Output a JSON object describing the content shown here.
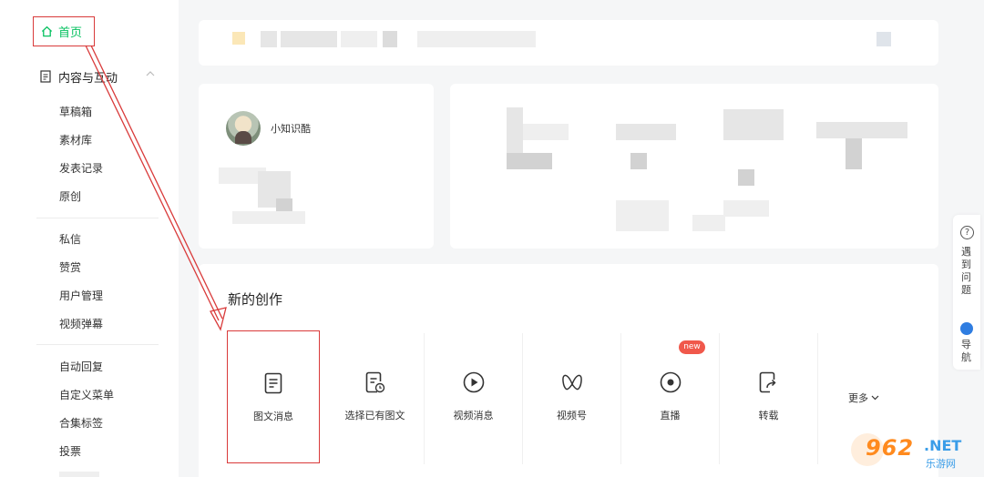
{
  "sidebar": {
    "home": "首页",
    "section": "内容与互动",
    "group1": [
      "草稿箱",
      "素材库",
      "发表记录",
      "原创"
    ],
    "group2": [
      "私信",
      "赞赏",
      "用户管理",
      "视频弹幕"
    ],
    "group3": [
      "自动回复",
      "自定义菜单",
      "合集标签",
      "投票"
    ]
  },
  "profile": {
    "name": "小知识酷"
  },
  "creation": {
    "title": "新的创作",
    "tiles": [
      "图文消息",
      "选择已有图文",
      "视频消息",
      "视频号",
      "直播",
      "转载"
    ],
    "badge": "new",
    "more": "更多"
  },
  "helper": {
    "ask": "遇到问题",
    "nav": "导航"
  },
  "watermark": {
    "number": "962",
    "domain": ".NET",
    "name": "乐游网"
  },
  "colors": {
    "accent": "#07c160",
    "highlight": "#d93a3a",
    "badge": "#f0584b"
  }
}
